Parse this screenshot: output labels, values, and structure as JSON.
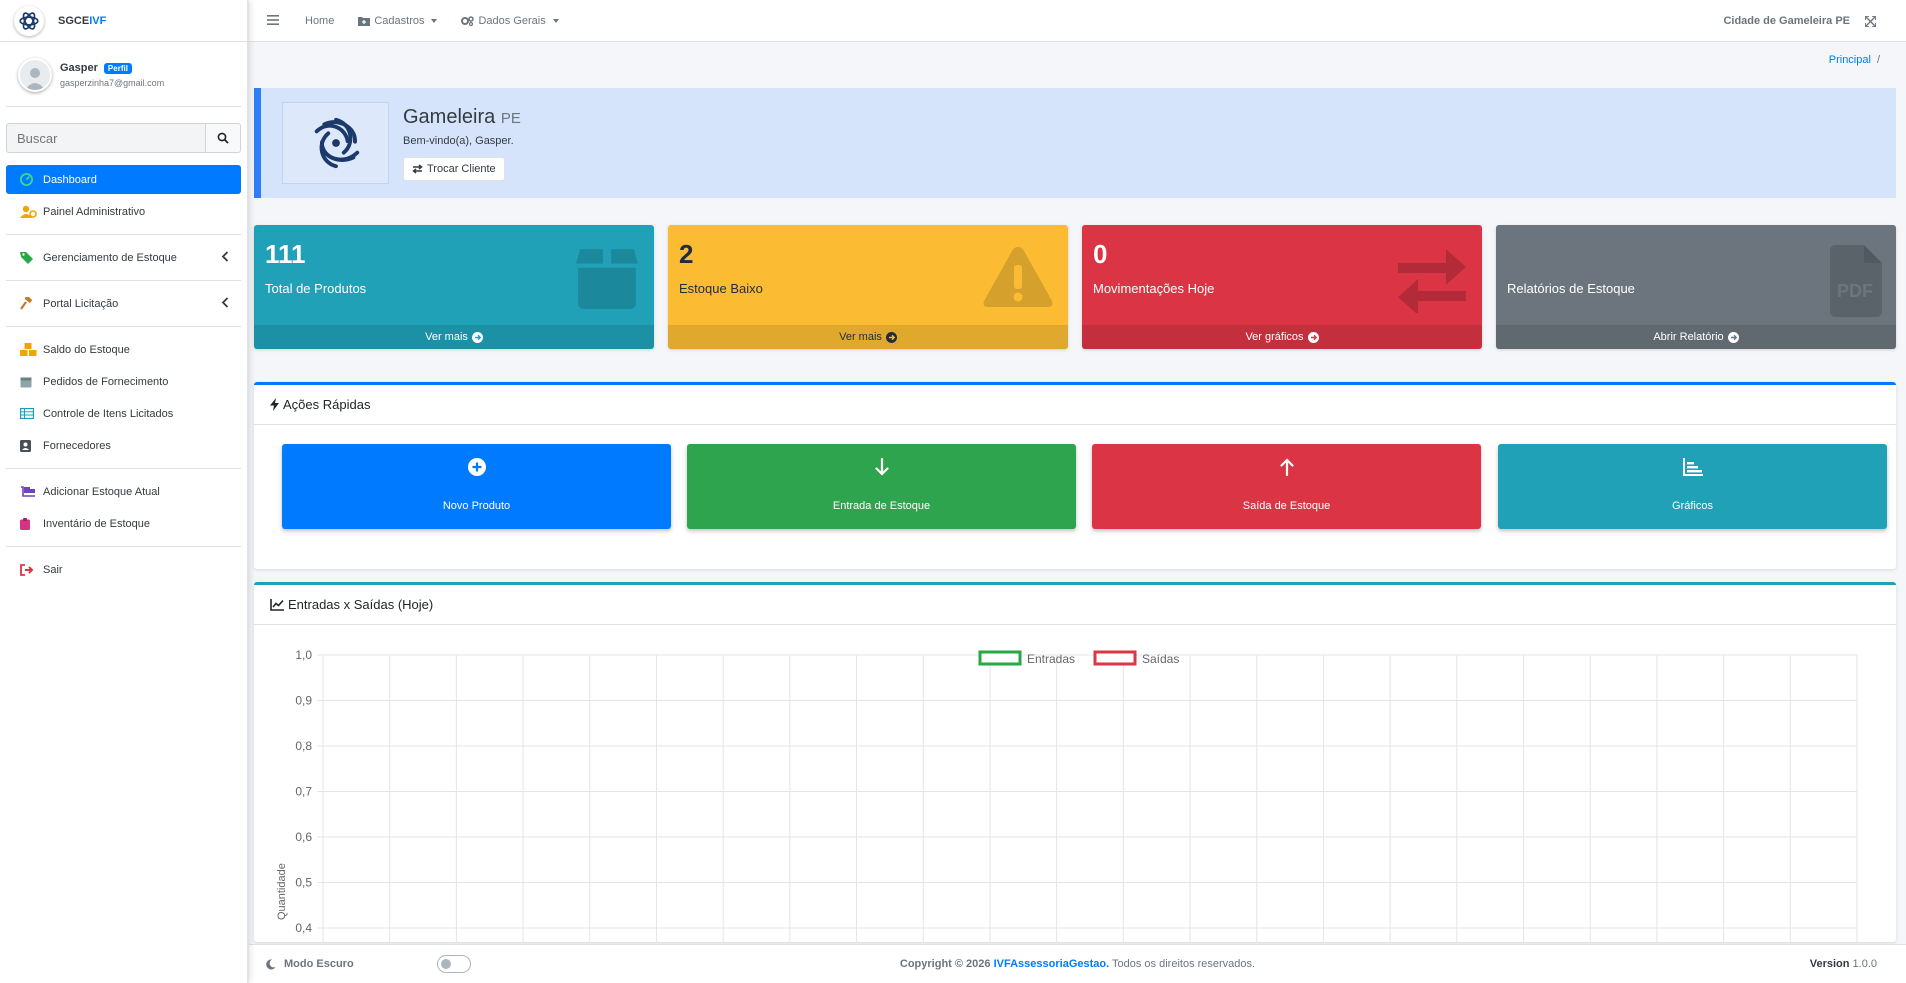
{
  "brand": {
    "name_main": "SGCE",
    "name_accent": "IVF"
  },
  "user": {
    "name": "Gasper",
    "badge": "Perfil",
    "email": "gasperzinha7@gmail.com"
  },
  "search": {
    "placeholder": "Buscar"
  },
  "sidebar": {
    "items": [
      {
        "label": "Dashboard",
        "icon": "dashboard-icon"
      },
      {
        "label": "Painel Administrativo",
        "icon": "user-gear-icon"
      },
      {
        "label": "Gerenciamento de Estoque",
        "icon": "tags-icon"
      },
      {
        "label": "Portal Licitação",
        "icon": "gavel-icon"
      },
      {
        "label": "Saldo do Estoque",
        "icon": "boxes-icon"
      },
      {
        "label": "Pedidos de Fornecimento",
        "icon": "calendar-icon"
      },
      {
        "label": "Controle de Itens Licitados",
        "icon": "table-icon"
      },
      {
        "label": "Fornecedores",
        "icon": "contact-icon"
      },
      {
        "label": "Adicionar Estoque Atual",
        "icon": "dolly-icon"
      },
      {
        "label": "Inventário de Estoque",
        "icon": "clipboard-icon"
      },
      {
        "label": "Sair",
        "icon": "sign-out-icon"
      }
    ]
  },
  "topbar": {
    "home": "Home",
    "cadastros": "Cadastros",
    "dados_gerais": "Dados Gerais",
    "city": "Cidade de Gameleira PE"
  },
  "breadcrumb": {
    "principal": "Principal",
    "sep": "/"
  },
  "hero": {
    "city": "Gameleira",
    "state": "PE",
    "welcome": "Bem-vindo(a), Gasper.",
    "button": "Trocar Cliente"
  },
  "boxes": [
    {
      "number": "111",
      "label": "Total de Produtos",
      "footer": "Ver mais",
      "icon": "box-icon"
    },
    {
      "number": "2",
      "label": "Estoque Baixo",
      "footer": "Ver mais",
      "icon": "warning-icon"
    },
    {
      "number": "0",
      "label": "Movimentações Hoje",
      "footer": "Ver gráficos",
      "icon": "exchange-icon"
    },
    {
      "number": "",
      "label": "Relatórios de Estoque",
      "footer": "Abrir Relatório",
      "icon": "pdf-icon"
    }
  ],
  "quick": {
    "title": "Ações Rápidas",
    "buttons": [
      {
        "label": "Novo Produto",
        "icon": "plus-circle-icon"
      },
      {
        "label": "Entrada de Estoque",
        "icon": "arrow-down-icon"
      },
      {
        "label": "Saída de Estoque",
        "icon": "arrow-up-icon"
      },
      {
        "label": "Gráficos",
        "icon": "bar-chart-icon"
      }
    ]
  },
  "chart_section": {
    "title": "Entradas x Saídas (Hoje)"
  },
  "chart_data": {
    "type": "line",
    "title": "",
    "ylabel": "Quantidade",
    "xlabel": "",
    "ylim": [
      0,
      1
    ],
    "y_ticks": [
      "1,0",
      "0,9",
      "0,8",
      "0,7",
      "0,6",
      "0,5",
      "0,4"
    ],
    "legend_position": "top-center",
    "series": [
      {
        "name": "Entradas",
        "color": "#28a745",
        "values": []
      },
      {
        "name": "Saídas",
        "color": "#dc3545",
        "values": []
      }
    ],
    "grid": true
  },
  "footer": {
    "dark_mode": "Modo Escuro",
    "copyright_prefix": "Copyright © 2026",
    "company": "IVFAssessoriaGestao.",
    "rights": "Todos os direitos reservados.",
    "version_label": "Version",
    "version": "1.0.0"
  }
}
